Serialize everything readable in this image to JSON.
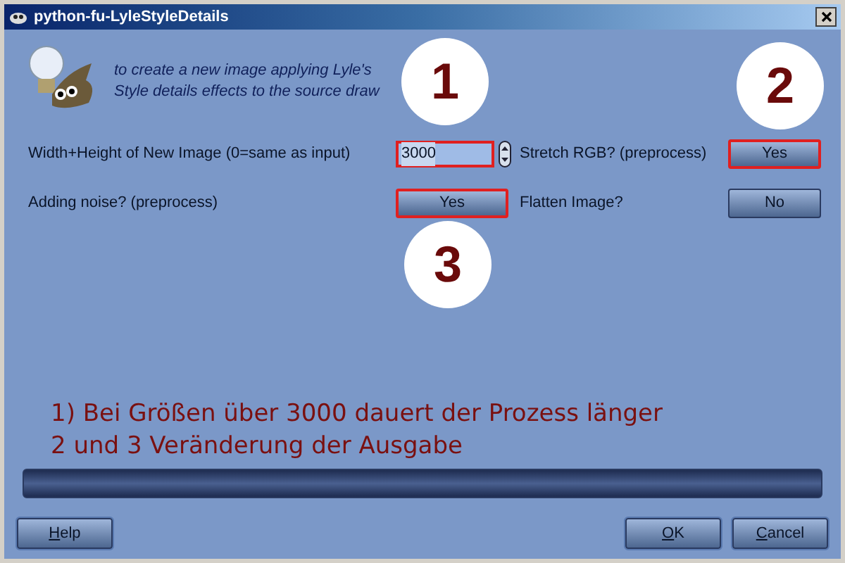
{
  "window": {
    "title": "python-fu-LyleStyleDetails"
  },
  "description": [
    "to create a new image applying Lyle's",
    "Style details effects to the source draw"
  ],
  "options": [
    {
      "kind": "number",
      "label": "Width+Height of New Image (0=same as input)",
      "value": "3000",
      "highlighted": true
    },
    {
      "kind": "toggle",
      "label": "Stretch RGB? (preprocess)",
      "value": "Yes",
      "highlighted": true
    },
    {
      "kind": "toggle",
      "label": "Adding noise? (preprocess)",
      "value": "Yes",
      "highlighted": true
    },
    {
      "kind": "toggle",
      "label": "Flatten Image?",
      "value": "No",
      "highlighted": false
    }
  ],
  "callouts": [
    "1",
    "2",
    "3"
  ],
  "notes": [
    "1) Bei Größen über 3000 dauert der Prozess länger",
    "2 und 3 Veränderung der Ausgabe"
  ],
  "progress": {
    "level": 0
  },
  "help_button": "Help",
  "buttons": [
    "OK",
    "Cancel"
  ]
}
